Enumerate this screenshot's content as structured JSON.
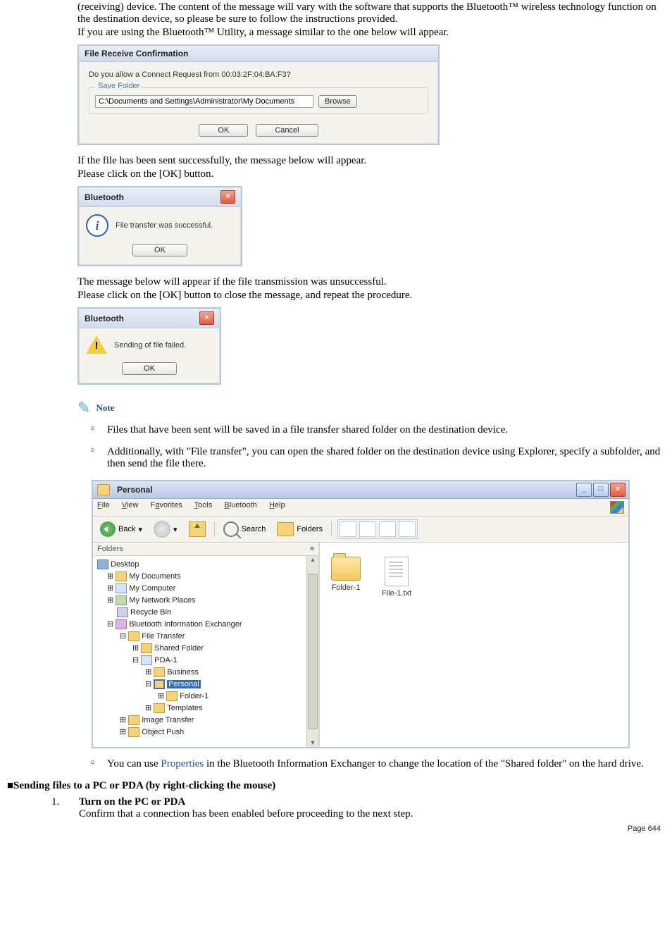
{
  "intro": {
    "p1": "(receiving) device. The content of the message will vary with the software that supports the Bluetooth™ wireless technology function on the destination device, so please be sure to follow the instructions provided.",
    "p2": "If you are using the Bluetooth™ Utility, a message similar to the one below will appear."
  },
  "dialog1": {
    "title": "File Receive Confirmation",
    "prompt": "Do you allow a Connect Request from 00:03:2F:04:BA:F3?",
    "group": "Save Folder",
    "path": "C:\\Documents and Settings\\Administrator\\My Documents",
    "browse": "Browse",
    "ok": "OK",
    "cancel": "Cancel"
  },
  "after1": {
    "p1": "If the file has been sent successfully, the message below will appear.",
    "p2": "Please click on the [OK] button."
  },
  "msg_success": {
    "title": "Bluetooth",
    "text": "File transfer was successful.",
    "ok": "OK"
  },
  "after2": {
    "p1": "The message below will appear if the file transmission was unsuccessful.",
    "p2": "Please click on the [OK] button to close the message, and repeat the procedure."
  },
  "msg_fail": {
    "title": "Bluetooth",
    "text": "Sending of file failed.",
    "ok": "OK"
  },
  "note": {
    "label": "Note",
    "items": [
      "Files that have been sent will be saved in a file transfer shared folder on the destination device.",
      "Additionally, with \"File transfer\", you can open the shared folder on the destination device using Explorer, specify a subfolder, and then send the file there."
    ],
    "last_pre": "You can use ",
    "last_link": "Properties",
    "last_post": " in the Bluetooth Information Exchanger to change the location of the \"Shared folder\" on the hard drive."
  },
  "explorer": {
    "title": "Personal",
    "menu": {
      "file": "File",
      "view": "View",
      "favorites": "Favorites",
      "tools": "Tools",
      "bluetooth": "Bluetooth",
      "help": "Help"
    },
    "toolbar": {
      "back": "Back",
      "search": "Search",
      "folders": "Folders"
    },
    "folders_label": "Folders",
    "tree": {
      "desktop": "Desktop",
      "mydocs": "My Documents",
      "mycomp": "My Computer",
      "mynet": "My Network Places",
      "rbin": "Recycle Bin",
      "bie": "Bluetooth Information Exchanger",
      "ft": "File Transfer",
      "shared": "Shared Folder",
      "pda1": "PDA-1",
      "business": "Business",
      "personal": "Personal",
      "folder1": "Folder-1",
      "templates": "Templates",
      "imgtrans": "Image Transfer",
      "objpush": "Object Push"
    },
    "content": {
      "folder": "Folder-1",
      "file": "File-1.txt"
    }
  },
  "section2": {
    "heading": "■Sending files to a PC or PDA (by right-clicking the mouse)",
    "step1_title": "Turn on the PC or PDA",
    "step1_body": "Confirm that a connection has been enabled before proceeding to the next step."
  },
  "page": "Page 644"
}
